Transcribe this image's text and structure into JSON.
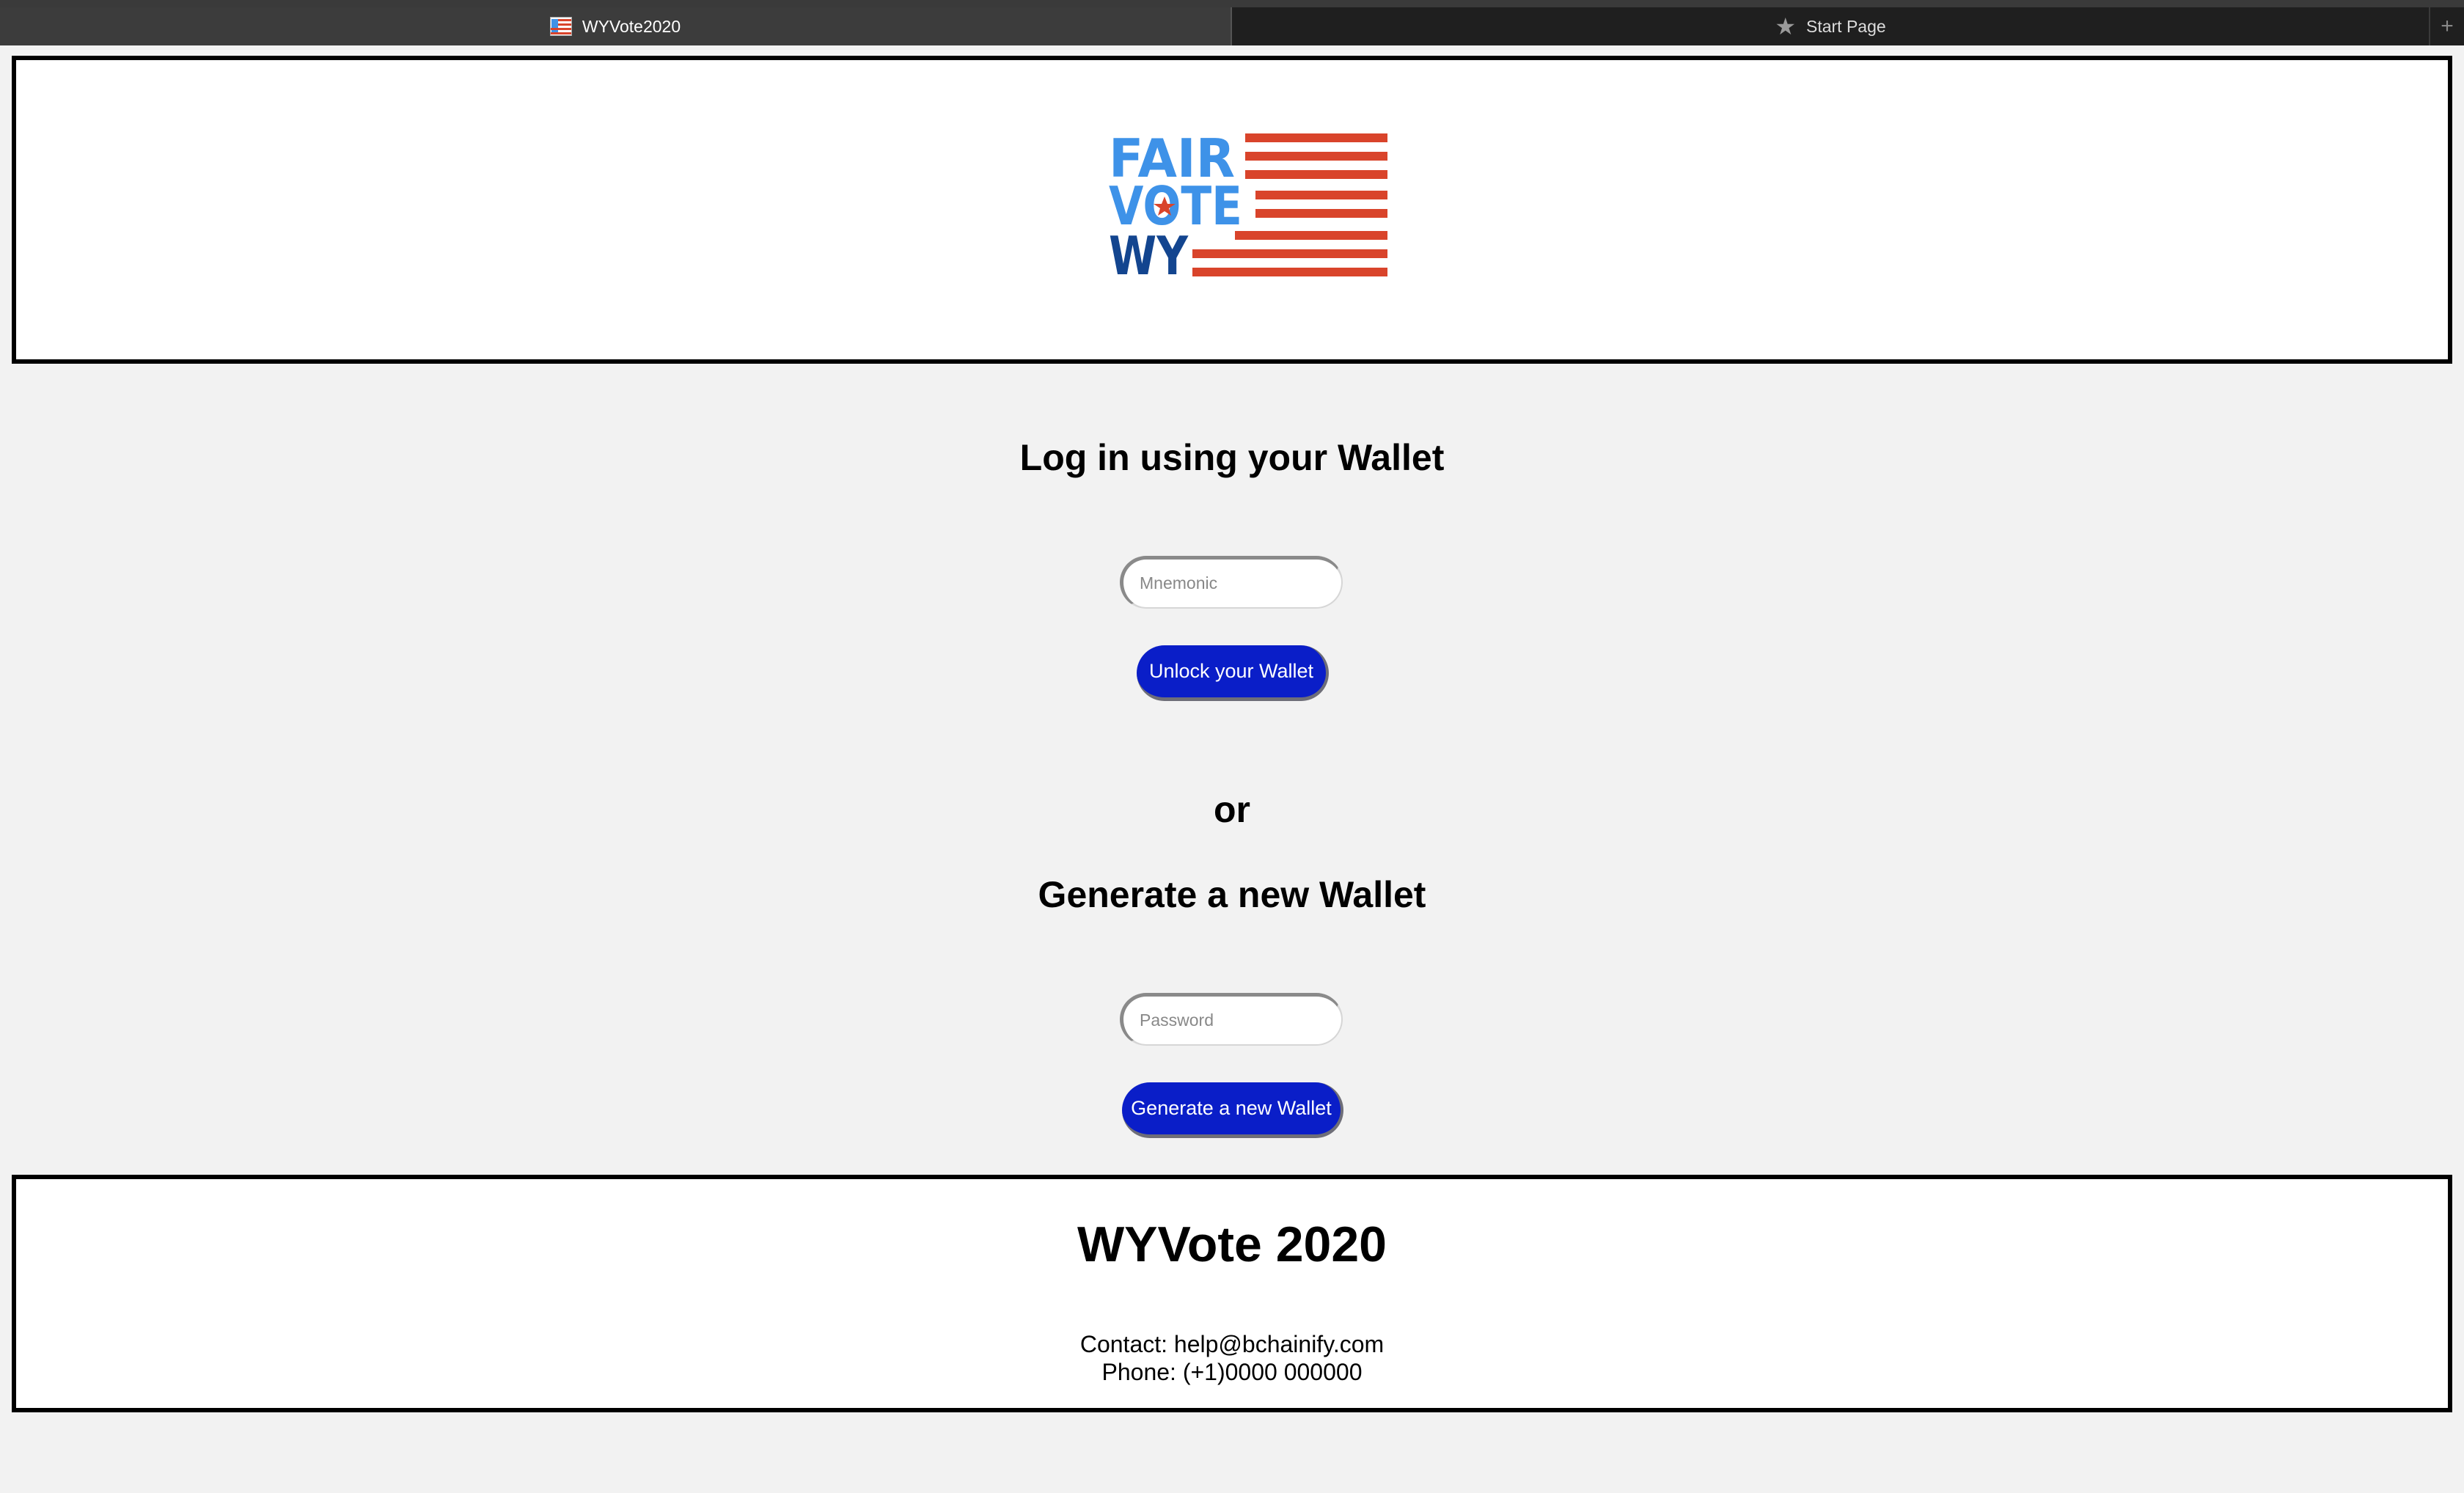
{
  "browser": {
    "tabs": [
      {
        "label": "WYVote2020",
        "icon": "flag-favicon",
        "active": true
      },
      {
        "label": "Start Page",
        "icon": "star-icon",
        "active": false
      }
    ],
    "new_tab_label": "+"
  },
  "header": {
    "logo": {
      "lines": [
        "FAIR",
        "VOTE",
        "WY"
      ],
      "colors": {
        "light_blue": "#3e92e8",
        "dark_blue": "#13458f",
        "red": "#d9442b"
      }
    }
  },
  "login": {
    "heading": "Log in using your Wallet",
    "mnemonic_placeholder": "Mnemonic",
    "unlock_button": "Unlock your Wallet"
  },
  "separator": "or",
  "generate": {
    "heading": "Generate a new Wallet",
    "password_placeholder": "Password",
    "generate_button": "Generate a new Wallet"
  },
  "footer": {
    "title": "WYVote 2020",
    "contact": "Contact: help@bchainify.com",
    "phone": "Phone: (+1)0000 000000"
  },
  "colors": {
    "button_bg": "#0a1ec8",
    "page_bg": "#f2f2f2"
  }
}
